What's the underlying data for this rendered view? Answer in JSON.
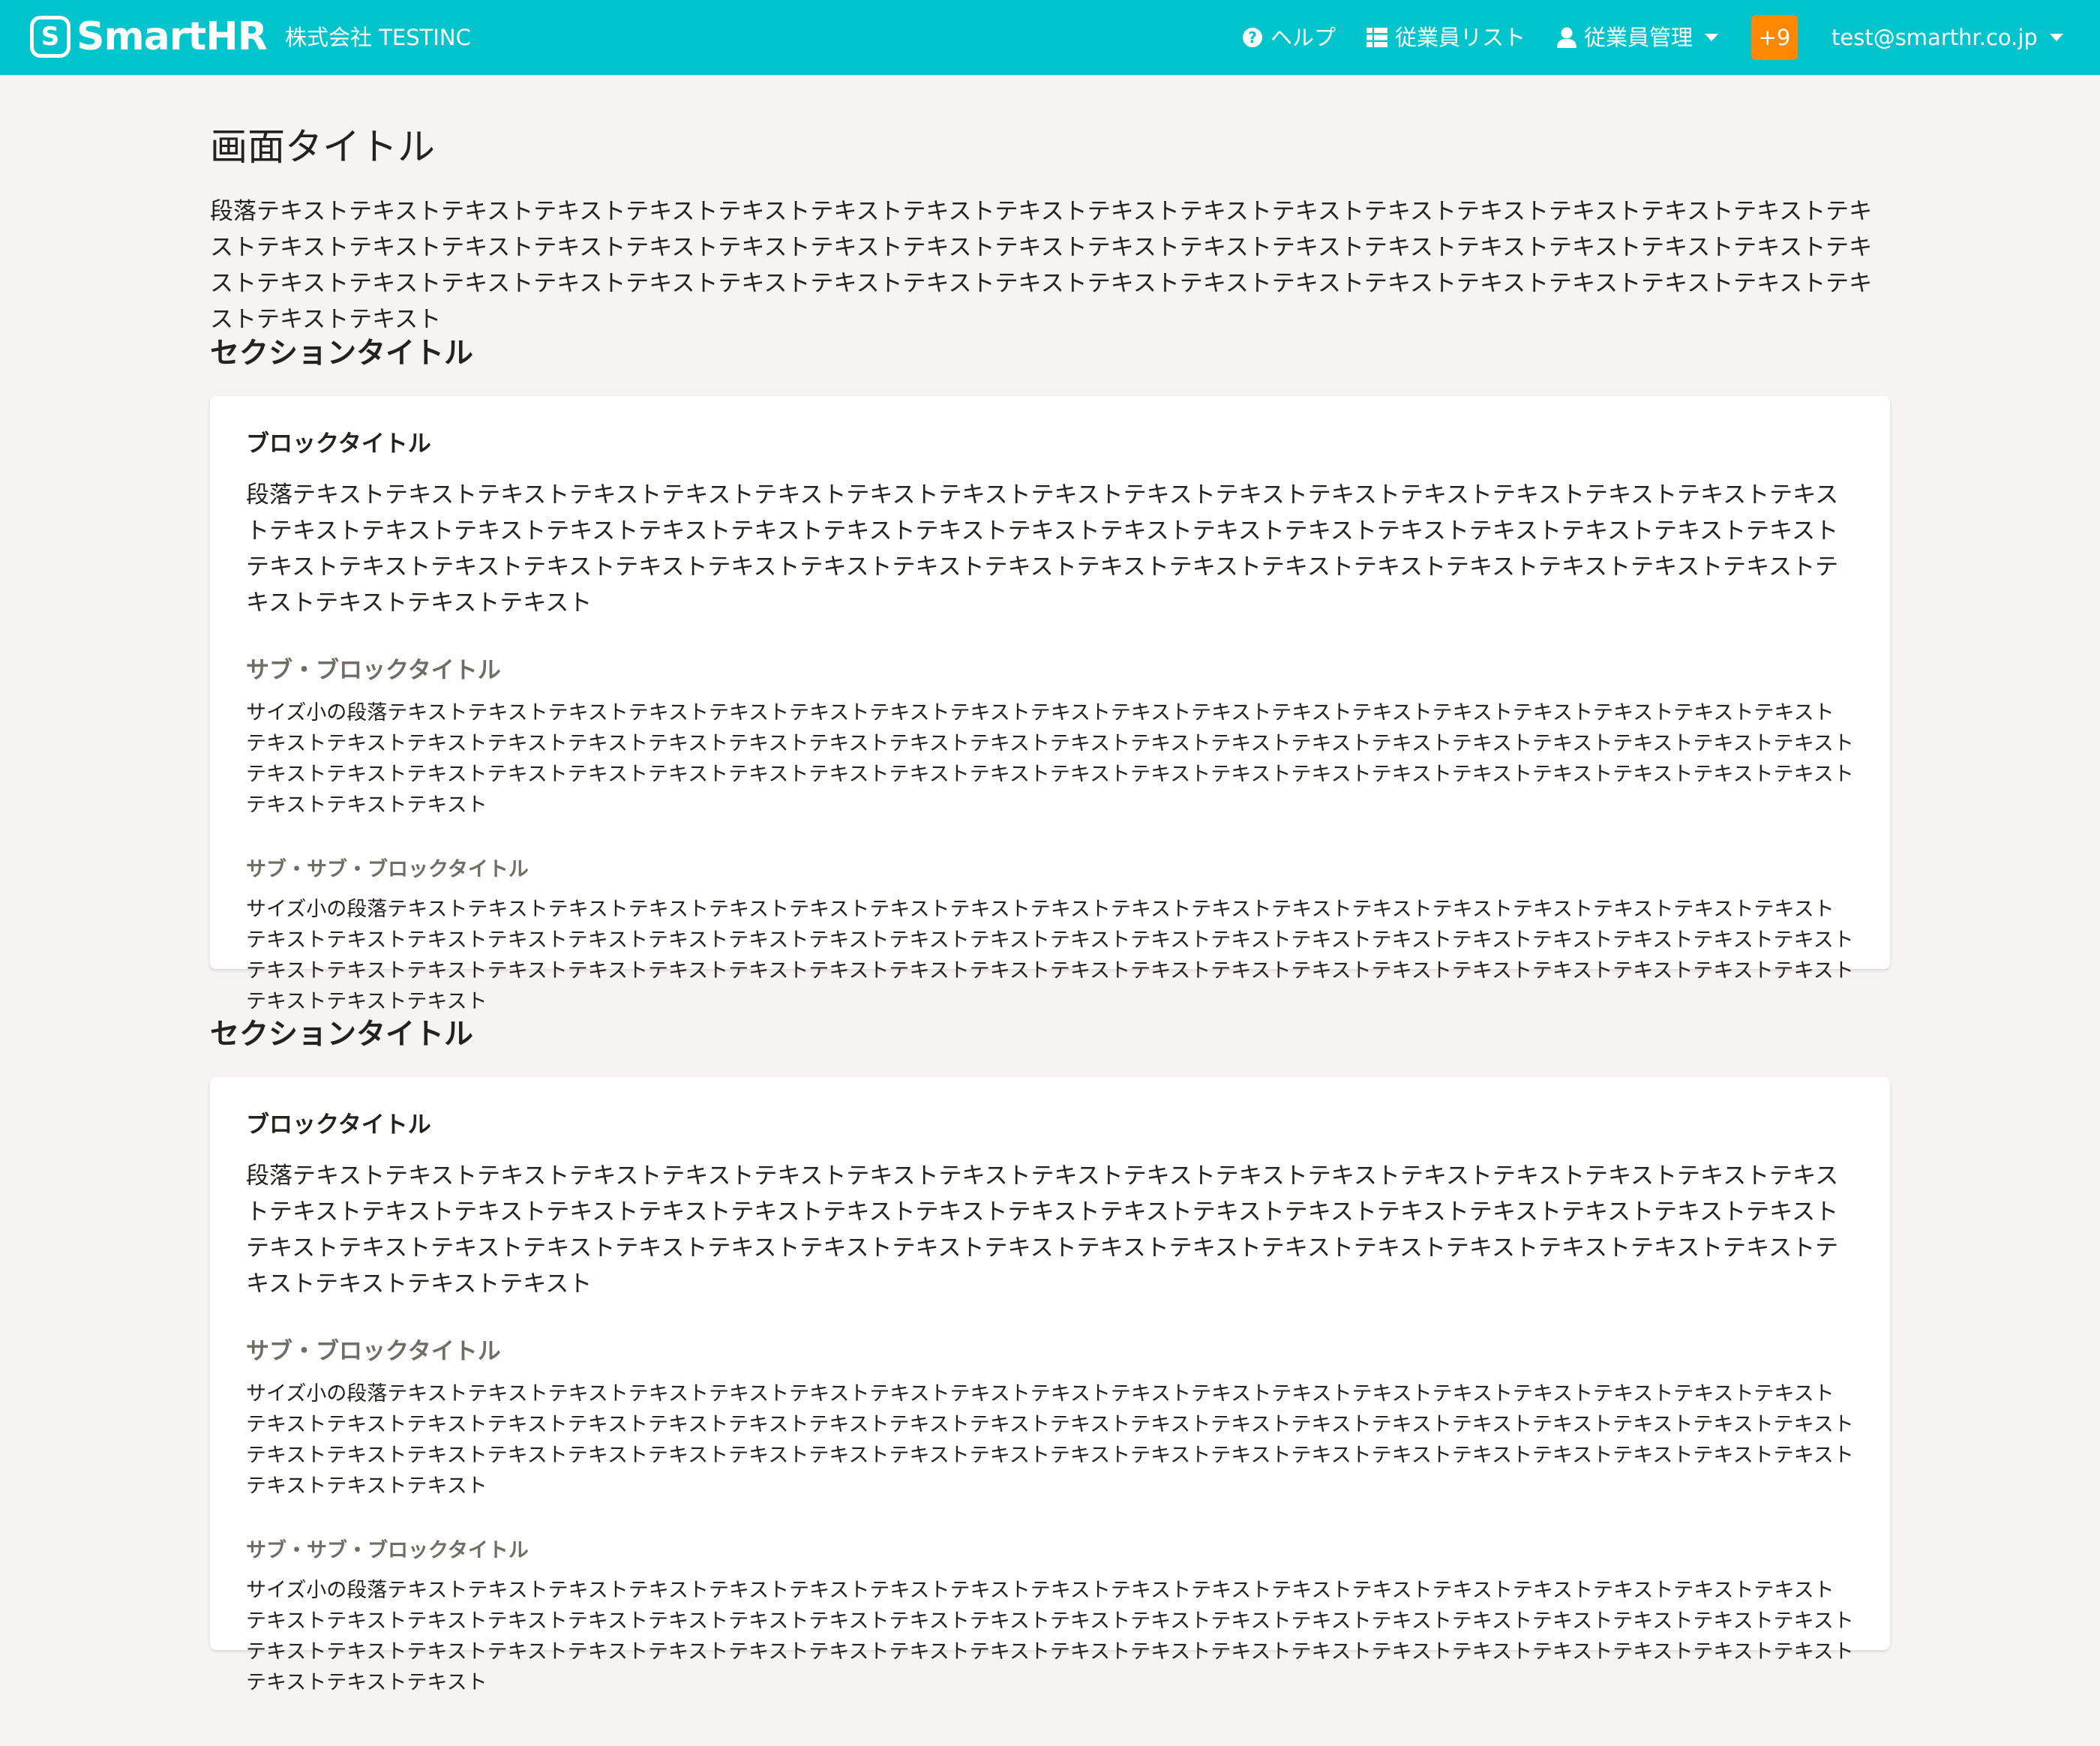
{
  "header": {
    "logo_mark": "S",
    "logo_text": "SmartHR",
    "company": "株式会社 TESTINC",
    "nav": {
      "help": "ヘルプ",
      "employee_list": "従業員リスト",
      "employee_manage": "従業員管理",
      "badge": "+9",
      "user": "test@smarthr.co.jp"
    },
    "colors": {
      "bar": "#00c4cc",
      "badge": "#ff8800"
    },
    "icons": [
      "question-circle-icon",
      "list-icon",
      "user-icon",
      "caret-down-icon"
    ]
  },
  "main": {
    "page_title": "画面タイトル",
    "lead": "段落テキストテキストテキストテキストテキストテキストテキストテキストテキストテキストテキストテキストテキストテキストテキストテキストテキストテキストテキストテキストテキストテキストテキストテキストテキストテキストテキストテキストテキストテキストテキストテキストテキストテキストテキストテキストテキストテキストテキストテキストテキストテキストテキストテキストテキストテキストテキストテキストテキストテキストテキストテキストテキストテキストテキストテキスト",
    "sections": [
      {
        "title": "セクションタイトル",
        "block_title": "ブロックタイトル",
        "block_text": "段落テキストテキストテキストテキストテキストテキストテキストテキストテキストテキストテキストテキストテキストテキストテキストテキストテキストテキストテキストテキストテキストテキストテキストテキストテキストテキストテキストテキストテキストテキストテキストテキストテキストテキストテキストテキストテキストテキストテキストテキストテキストテキストテキストテキストテキストテキストテキストテキストテキストテキストテキストテキストテキストテキストテキスト",
        "sub_title": "サブ・ブロックタイトル",
        "sub_text": "サイズ小の段落テキストテキストテキストテキストテキストテキストテキストテキストテキストテキストテキストテキストテキストテキストテキストテキストテキストテキストテキストテキストテキストテキストテキストテキストテキストテキストテキストテキストテキストテキストテキストテキストテキストテキストテキストテキストテキストテキストテキストテキストテキストテキストテキストテキストテキストテキストテキストテキストテキストテキストテキストテキストテキストテキストテキストテキストテキストテキストテキストテキストテキスト",
        "subsub_title": "サブ・サブ・ブロックタイトル",
        "subsub_text": "サイズ小の段落テキストテキストテキストテキストテキストテキストテキストテキストテキストテキストテキストテキストテキストテキストテキストテキストテキストテキストテキストテキストテキストテキストテキストテキストテキストテキストテキストテキストテキストテキストテキストテキストテキストテキストテキストテキストテキストテキストテキストテキストテキストテキストテキストテキストテキストテキストテキストテキストテキストテキストテキストテキストテキストテキストテキストテキストテキストテキストテキストテキストテキスト"
      },
      {
        "title": "セクションタイトル",
        "block_title": "ブロックタイトル",
        "block_text": "段落テキストテキストテキストテキストテキストテキストテキストテキストテキストテキストテキストテキストテキストテキストテキストテキストテキストテキストテキストテキストテキストテキストテキストテキストテキストテキストテキストテキストテキストテキストテキストテキストテキストテキストテキストテキストテキストテキストテキストテキストテキストテキストテキストテキストテキストテキストテキストテキストテキストテキストテキストテキストテキストテキストテキスト",
        "sub_title": "サブ・ブロックタイトル",
        "sub_text": "サイズ小の段落テキストテキストテキストテキストテキストテキストテキストテキストテキストテキストテキストテキストテキストテキストテキストテキストテキストテキストテキストテキストテキストテキストテキストテキストテキストテキストテキストテキストテキストテキストテキストテキストテキストテキストテキストテキストテキストテキストテキストテキストテキストテキストテキストテキストテキストテキストテキストテキストテキストテキストテキストテキストテキストテキストテキストテキストテキストテキストテキストテキストテキスト",
        "subsub_title": "サブ・サブ・ブロックタイトル",
        "subsub_text": "サイズ小の段落テキストテキストテキストテキストテキストテキストテキストテキストテキストテキストテキストテキストテキストテキストテキストテキストテキストテキストテキストテキストテキストテキストテキストテキストテキストテキストテキストテキストテキストテキストテキストテキストテキストテキストテキストテキストテキストテキストテキストテキストテキストテキストテキストテキストテキストテキストテキストテキストテキストテキストテキストテキストテキストテキストテキストテキストテキストテキストテキストテキストテキスト"
      }
    ]
  }
}
